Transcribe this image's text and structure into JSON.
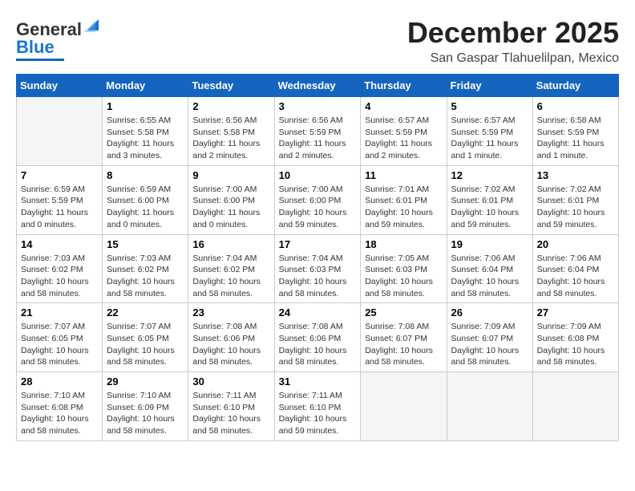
{
  "header": {
    "logo_line1": "General",
    "logo_line2": "Blue",
    "month": "December 2025",
    "location": "San Gaspar Tlahuelilpan, Mexico"
  },
  "weekdays": [
    "Sunday",
    "Monday",
    "Tuesday",
    "Wednesday",
    "Thursday",
    "Friday",
    "Saturday"
  ],
  "weeks": [
    [
      {
        "day": "",
        "sunrise": "",
        "sunset": "",
        "daylight": ""
      },
      {
        "day": "1",
        "sunrise": "Sunrise: 6:55 AM",
        "sunset": "Sunset: 5:58 PM",
        "daylight": "Daylight: 11 hours and 3 minutes."
      },
      {
        "day": "2",
        "sunrise": "Sunrise: 6:56 AM",
        "sunset": "Sunset: 5:58 PM",
        "daylight": "Daylight: 11 hours and 2 minutes."
      },
      {
        "day": "3",
        "sunrise": "Sunrise: 6:56 AM",
        "sunset": "Sunset: 5:59 PM",
        "daylight": "Daylight: 11 hours and 2 minutes."
      },
      {
        "day": "4",
        "sunrise": "Sunrise: 6:57 AM",
        "sunset": "Sunset: 5:59 PM",
        "daylight": "Daylight: 11 hours and 2 minutes."
      },
      {
        "day": "5",
        "sunrise": "Sunrise: 6:57 AM",
        "sunset": "Sunset: 5:59 PM",
        "daylight": "Daylight: 11 hours and 1 minute."
      },
      {
        "day": "6",
        "sunrise": "Sunrise: 6:58 AM",
        "sunset": "Sunset: 5:59 PM",
        "daylight": "Daylight: 11 hours and 1 minute."
      }
    ],
    [
      {
        "day": "7",
        "sunrise": "Sunrise: 6:59 AM",
        "sunset": "Sunset: 5:59 PM",
        "daylight": "Daylight: 11 hours and 0 minutes."
      },
      {
        "day": "8",
        "sunrise": "Sunrise: 6:59 AM",
        "sunset": "Sunset: 6:00 PM",
        "daylight": "Daylight: 11 hours and 0 minutes."
      },
      {
        "day": "9",
        "sunrise": "Sunrise: 7:00 AM",
        "sunset": "Sunset: 6:00 PM",
        "daylight": "Daylight: 11 hours and 0 minutes."
      },
      {
        "day": "10",
        "sunrise": "Sunrise: 7:00 AM",
        "sunset": "Sunset: 6:00 PM",
        "daylight": "Daylight: 10 hours and 59 minutes."
      },
      {
        "day": "11",
        "sunrise": "Sunrise: 7:01 AM",
        "sunset": "Sunset: 6:01 PM",
        "daylight": "Daylight: 10 hours and 59 minutes."
      },
      {
        "day": "12",
        "sunrise": "Sunrise: 7:02 AM",
        "sunset": "Sunset: 6:01 PM",
        "daylight": "Daylight: 10 hours and 59 minutes."
      },
      {
        "day": "13",
        "sunrise": "Sunrise: 7:02 AM",
        "sunset": "Sunset: 6:01 PM",
        "daylight": "Daylight: 10 hours and 59 minutes."
      }
    ],
    [
      {
        "day": "14",
        "sunrise": "Sunrise: 7:03 AM",
        "sunset": "Sunset: 6:02 PM",
        "daylight": "Daylight: 10 hours and 58 minutes."
      },
      {
        "day": "15",
        "sunrise": "Sunrise: 7:03 AM",
        "sunset": "Sunset: 6:02 PM",
        "daylight": "Daylight: 10 hours and 58 minutes."
      },
      {
        "day": "16",
        "sunrise": "Sunrise: 7:04 AM",
        "sunset": "Sunset: 6:02 PM",
        "daylight": "Daylight: 10 hours and 58 minutes."
      },
      {
        "day": "17",
        "sunrise": "Sunrise: 7:04 AM",
        "sunset": "Sunset: 6:03 PM",
        "daylight": "Daylight: 10 hours and 58 minutes."
      },
      {
        "day": "18",
        "sunrise": "Sunrise: 7:05 AM",
        "sunset": "Sunset: 6:03 PM",
        "daylight": "Daylight: 10 hours and 58 minutes."
      },
      {
        "day": "19",
        "sunrise": "Sunrise: 7:06 AM",
        "sunset": "Sunset: 6:04 PM",
        "daylight": "Daylight: 10 hours and 58 minutes."
      },
      {
        "day": "20",
        "sunrise": "Sunrise: 7:06 AM",
        "sunset": "Sunset: 6:04 PM",
        "daylight": "Daylight: 10 hours and 58 minutes."
      }
    ],
    [
      {
        "day": "21",
        "sunrise": "Sunrise: 7:07 AM",
        "sunset": "Sunset: 6:05 PM",
        "daylight": "Daylight: 10 hours and 58 minutes."
      },
      {
        "day": "22",
        "sunrise": "Sunrise: 7:07 AM",
        "sunset": "Sunset: 6:05 PM",
        "daylight": "Daylight: 10 hours and 58 minutes."
      },
      {
        "day": "23",
        "sunrise": "Sunrise: 7:08 AM",
        "sunset": "Sunset: 6:06 PM",
        "daylight": "Daylight: 10 hours and 58 minutes."
      },
      {
        "day": "24",
        "sunrise": "Sunrise: 7:08 AM",
        "sunset": "Sunset: 6:06 PM",
        "daylight": "Daylight: 10 hours and 58 minutes."
      },
      {
        "day": "25",
        "sunrise": "Sunrise: 7:08 AM",
        "sunset": "Sunset: 6:07 PM",
        "daylight": "Daylight: 10 hours and 58 minutes."
      },
      {
        "day": "26",
        "sunrise": "Sunrise: 7:09 AM",
        "sunset": "Sunset: 6:07 PM",
        "daylight": "Daylight: 10 hours and 58 minutes."
      },
      {
        "day": "27",
        "sunrise": "Sunrise: 7:09 AM",
        "sunset": "Sunset: 6:08 PM",
        "daylight": "Daylight: 10 hours and 58 minutes."
      }
    ],
    [
      {
        "day": "28",
        "sunrise": "Sunrise: 7:10 AM",
        "sunset": "Sunset: 6:08 PM",
        "daylight": "Daylight: 10 hours and 58 minutes."
      },
      {
        "day": "29",
        "sunrise": "Sunrise: 7:10 AM",
        "sunset": "Sunset: 6:09 PM",
        "daylight": "Daylight: 10 hours and 58 minutes."
      },
      {
        "day": "30",
        "sunrise": "Sunrise: 7:11 AM",
        "sunset": "Sunset: 6:10 PM",
        "daylight": "Daylight: 10 hours and 58 minutes."
      },
      {
        "day": "31",
        "sunrise": "Sunrise: 7:11 AM",
        "sunset": "Sunset: 6:10 PM",
        "daylight": "Daylight: 10 hours and 59 minutes."
      },
      {
        "day": "",
        "sunrise": "",
        "sunset": "",
        "daylight": ""
      },
      {
        "day": "",
        "sunrise": "",
        "sunset": "",
        "daylight": ""
      },
      {
        "day": "",
        "sunrise": "",
        "sunset": "",
        "daylight": ""
      }
    ]
  ]
}
